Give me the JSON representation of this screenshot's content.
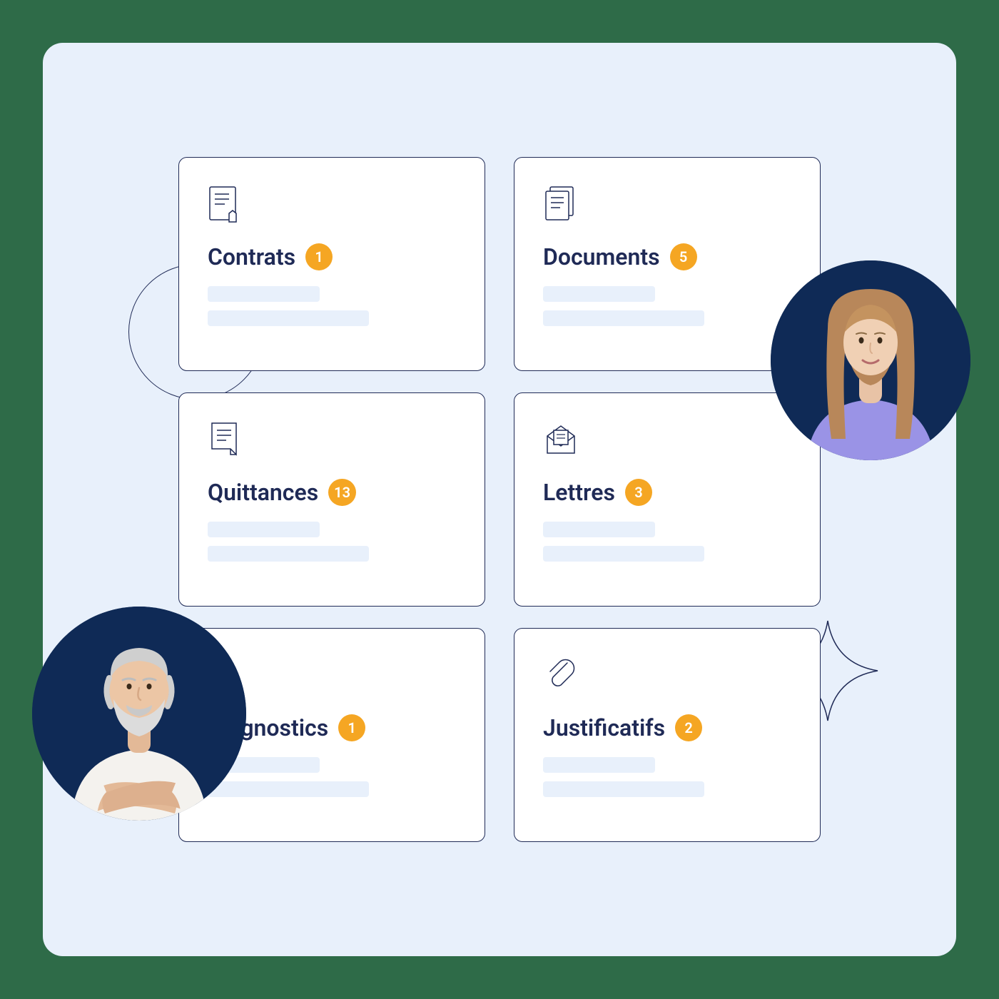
{
  "colors": {
    "page_bg": "#2e6b48",
    "panel_bg": "#e8f0fb",
    "card_bg": "#ffffff",
    "border": "#1f2a56",
    "title": "#1f2a56",
    "badge_bg": "#f5a623",
    "badge_fg": "#ffffff",
    "placeholder": "#e8f0fb",
    "avatar_bg": "#0f2a56"
  },
  "cards": [
    {
      "icon": "contract-icon",
      "label": "Contrats",
      "count": "1"
    },
    {
      "icon": "documents-icon",
      "label": "Documents",
      "count": "5"
    },
    {
      "icon": "receipt-icon",
      "label": "Quittances",
      "count": "13"
    },
    {
      "icon": "envelope-icon",
      "label": "Lettres",
      "count": "3"
    },
    {
      "icon": "diagnostic-icon",
      "label": "Diagnostics",
      "count": "1"
    },
    {
      "icon": "paperclip-icon",
      "label": "Justificatifs",
      "count": "2"
    }
  ],
  "avatars": {
    "left": "older-man-arms-crossed",
    "right": "young-woman"
  }
}
